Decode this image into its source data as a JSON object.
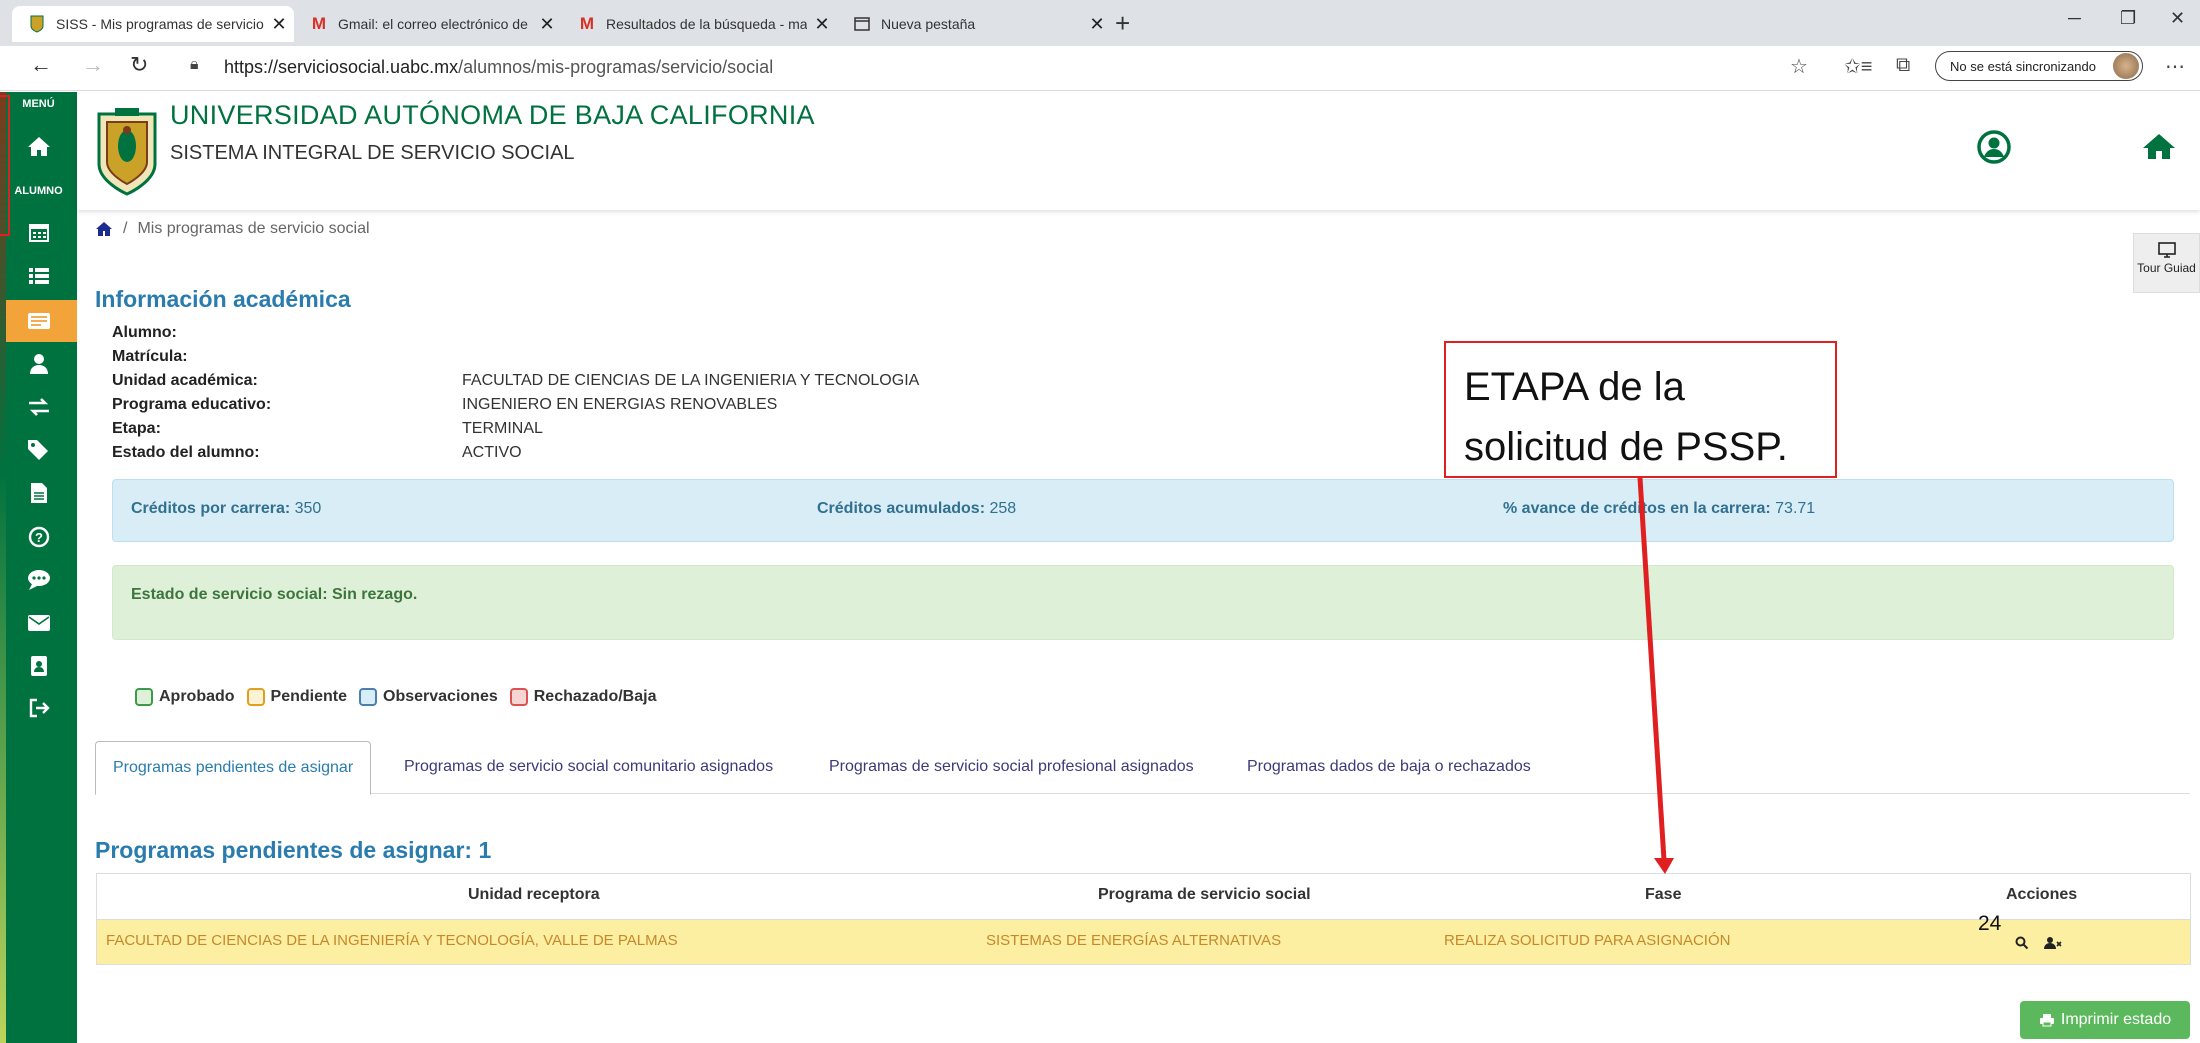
{
  "browser": {
    "tabs": [
      {
        "title": "SISS - Mis programas de servicio",
        "icon": "uabc-crest-icon",
        "active": true
      },
      {
        "title": "Gmail: el correo electrónico de G",
        "icon": "gmail-icon",
        "active": false
      },
      {
        "title": "Resultados de la búsqueda - ma",
        "icon": "gmail-icon",
        "active": false
      },
      {
        "title": "Nueva pestaña",
        "icon": "new-tab-page-icon",
        "active": false
      }
    ],
    "url_host": "https://serviciosocial.uabc.mx",
    "url_path": "/alumnos/mis-programas/servicio/social",
    "sync_label": "No se está sincronizando"
  },
  "sidebar": {
    "menu_label": "MENÚ",
    "alumno_label": "ALUMNO",
    "items": [
      {
        "icon": "home-icon"
      },
      {
        "icon": "calendar-icon"
      },
      {
        "icon": "list-icon"
      },
      {
        "icon": "id-card-icon",
        "active": true
      },
      {
        "icon": "user-icon"
      },
      {
        "icon": "exchange-icon"
      },
      {
        "icon": "tags-icon"
      },
      {
        "icon": "file-icon"
      },
      {
        "icon": "question-icon"
      },
      {
        "icon": "comment-icon"
      },
      {
        "icon": "envelope-icon"
      },
      {
        "icon": "address-book-icon"
      },
      {
        "icon": "sign-out-icon"
      }
    ]
  },
  "header": {
    "university": "UNIVERSIDAD AUTÓNOMA DE BAJA CALIFORNIA",
    "system": "SISTEMA INTEGRAL DE SERVICIO SOCIAL"
  },
  "breadcrumb": {
    "current": "Mis programas de servicio social"
  },
  "tour": {
    "label": "Tour Guiad"
  },
  "academic": {
    "title": "Información académica",
    "fields": [
      {
        "label": "Alumno:",
        "value": ""
      },
      {
        "label": "Matrícula:",
        "value": ""
      },
      {
        "label": "Unidad académica:",
        "value": "FACULTAD DE CIENCIAS DE LA INGENIERIA Y TECNOLOGIA"
      },
      {
        "label": "Programa educativo:",
        "value": "INGENIERO EN ENERGIAS RENOVABLES"
      },
      {
        "label": "Etapa:",
        "value": "TERMINAL"
      },
      {
        "label": "Estado del alumno:",
        "value": "ACTIVO"
      }
    ]
  },
  "credits": {
    "carrera_label": "Créditos por carrera:",
    "carrera_value": "350",
    "acumulados_label": "Créditos acumulados:",
    "acumulados_value": "258",
    "avance_label": "% avance de créditos en la carrera:",
    "avance_value": "73.71"
  },
  "status": {
    "text": "Estado de servicio social: Sin rezago."
  },
  "legend": [
    {
      "label": "Aprobado",
      "border": "#3c9a4b",
      "fill": "#dff0d8"
    },
    {
      "label": "Pendiente",
      "border": "#e0a01e",
      "fill": "#fcf3d4"
    },
    {
      "label": "Observaciones",
      "border": "#4a7fb0",
      "fill": "#d9edf7"
    },
    {
      "label": "Rechazado/Baja",
      "border": "#d9534f",
      "fill": "#f6d6d5"
    }
  ],
  "program_tabs": [
    {
      "label": "Programas pendientes de asignar",
      "active": true
    },
    {
      "label": "Programas de servicio social comunitario asignados"
    },
    {
      "label": "Programas de servicio social profesional asignados"
    },
    {
      "label": "Programas dados de baja o rechazados"
    }
  ],
  "pending": {
    "title": "Programas pendientes de asignar: 1",
    "columns": [
      "Unidad receptora",
      "Programa de servicio social",
      "Fase",
      "Acciones"
    ],
    "rows": [
      {
        "unidad": "FACULTAD DE CIENCIAS DE LA INGENIERÍA Y TECNOLOGÍA, VALLE DE PALMAS",
        "programa": "SISTEMAS DE ENERGÍAS ALTERNATIVAS",
        "fase": "REALIZA SOLICITUD PARA ASIGNACIÓN"
      }
    ]
  },
  "slide_number": "24",
  "print_button": "Imprimir estado",
  "annotation": {
    "line1": "ETAPA de la",
    "line2": "solicitud de PSSP."
  },
  "colors": {
    "uabc_green": "#00723f",
    "active_menu": "#f2a33a",
    "accent_blue": "#2a7cae",
    "annotation_red": "#e02020"
  }
}
